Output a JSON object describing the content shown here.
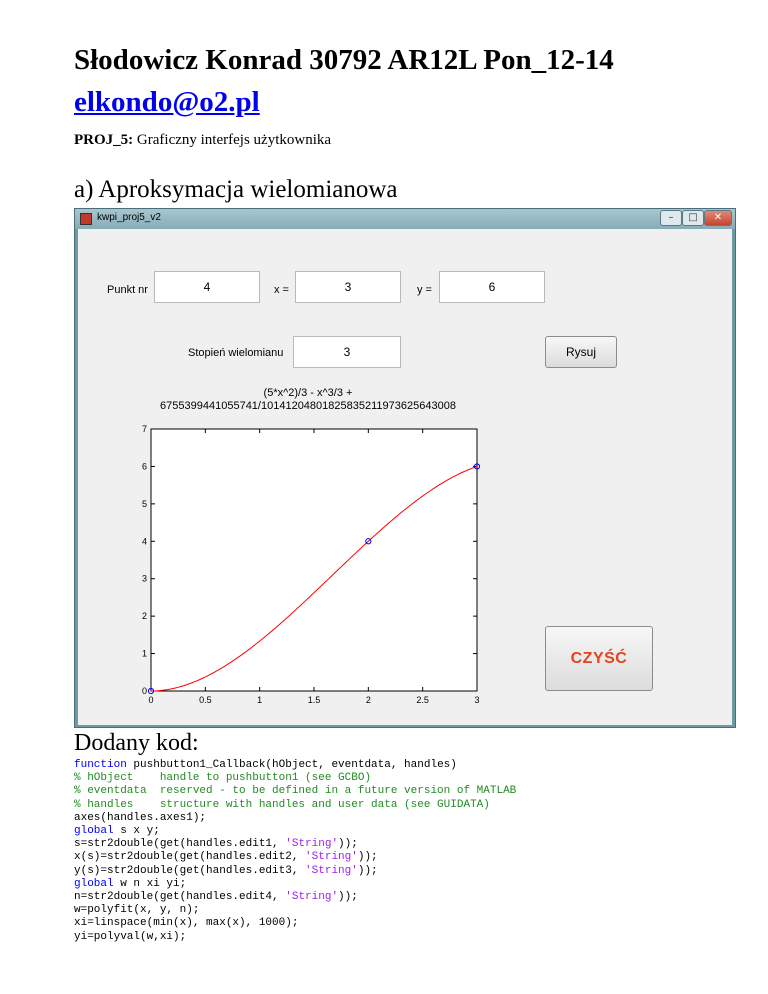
{
  "doc": {
    "title": "Słodowicz Konrad 30792 AR12L Pon_12-14",
    "email": "elkondo@o2.pl",
    "proj_label": "PROJ_5:",
    "proj_text": " Graficzny interfejs użytkownika",
    "section_heading": "a) Aproksymacja wielomianowa",
    "code_heading": "Dodany kod:"
  },
  "window": {
    "title": "kwpi_proj5_v2",
    "minimize_glyph": "–",
    "maximize_glyph": "□",
    "close_glyph": "✕",
    "icon": "matlab-figure-icon"
  },
  "form": {
    "punkt_label": "Punkt nr",
    "punkt_value": "4",
    "x_label": "x =",
    "x_value": "3",
    "y_label": "y =",
    "y_value": "6",
    "stopien_label": "Stopień wielomianu",
    "stopien_value": "3",
    "rysuj_label": "Rysuj",
    "czysc_label": "CZYŚĆ",
    "czysc_color": "#e8411d"
  },
  "formula": {
    "line1": "(5*x^2)/3 - x^3/3 +",
    "line2": "6755399441055741/1014120480182583521197362564300​8"
  },
  "chart_data": {
    "type": "line",
    "xlim": [
      0,
      3
    ],
    "ylim": [
      0,
      7
    ],
    "x_ticks": [
      "0",
      "0.5",
      "1",
      "1.5",
      "2",
      "2.5",
      "3"
    ],
    "y_ticks": [
      "0",
      "1",
      "2",
      "3",
      "4",
      "5",
      "6",
      "7"
    ],
    "series": [
      {
        "type": "line",
        "color": "#ff0000",
        "function": "(5*x^2)/3 - x^3/3",
        "x_range": [
          0,
          3
        ]
      },
      {
        "type": "scatter",
        "color": "#0000ff",
        "marker": "circle",
        "points": [
          [
            0,
            0
          ],
          [
            2,
            4
          ],
          [
            3,
            6
          ]
        ]
      }
    ],
    "grid": false
  },
  "code": {
    "lines": [
      [
        {
          "t": "function",
          "c": "kw"
        },
        {
          "t": " pushbutton1_Callback(hObject, eventdata, handles)",
          "c": ""
        }
      ],
      [
        {
          "t": "% hObject    handle to pushbutton1 (see GCBO)",
          "c": "cm"
        }
      ],
      [
        {
          "t": "% eventdata  reserved - to be defined in a future version of MATLAB",
          "c": "cm"
        }
      ],
      [
        {
          "t": "% handles    structure with handles and user data (see GUIDATA)",
          "c": "cm"
        }
      ],
      [
        {
          "t": "axes(handles.axes1);",
          "c": ""
        }
      ],
      [
        {
          "t": "global",
          "c": "kw"
        },
        {
          "t": " s x y;",
          "c": ""
        }
      ],
      [
        {
          "t": "s=str2double(get(handles.edit1, ",
          "c": ""
        },
        {
          "t": "'String'",
          "c": "st"
        },
        {
          "t": "));",
          "c": ""
        }
      ],
      [
        {
          "t": "x(s)=str2double(get(handles.edit2, ",
          "c": ""
        },
        {
          "t": "'String'",
          "c": "st"
        },
        {
          "t": "));",
          "c": ""
        }
      ],
      [
        {
          "t": "y(s)=str2double(get(handles.edit3, ",
          "c": ""
        },
        {
          "t": "'String'",
          "c": "st"
        },
        {
          "t": "));",
          "c": ""
        }
      ],
      [
        {
          "t": "global",
          "c": "kw"
        },
        {
          "t": " w n xi yi;",
          "c": ""
        }
      ],
      [
        {
          "t": "n=str2double(get(handles.edit4, ",
          "c": ""
        },
        {
          "t": "'String'",
          "c": "st"
        },
        {
          "t": "));",
          "c": ""
        }
      ],
      [
        {
          "t": "w=polyfit(x, y, n);",
          "c": ""
        }
      ],
      [
        {
          "t": "xi=linspace(min(x), max(x), 1000);",
          "c": ""
        }
      ],
      [
        {
          "t": "yi=polyval(w,xi);",
          "c": ""
        }
      ]
    ]
  }
}
